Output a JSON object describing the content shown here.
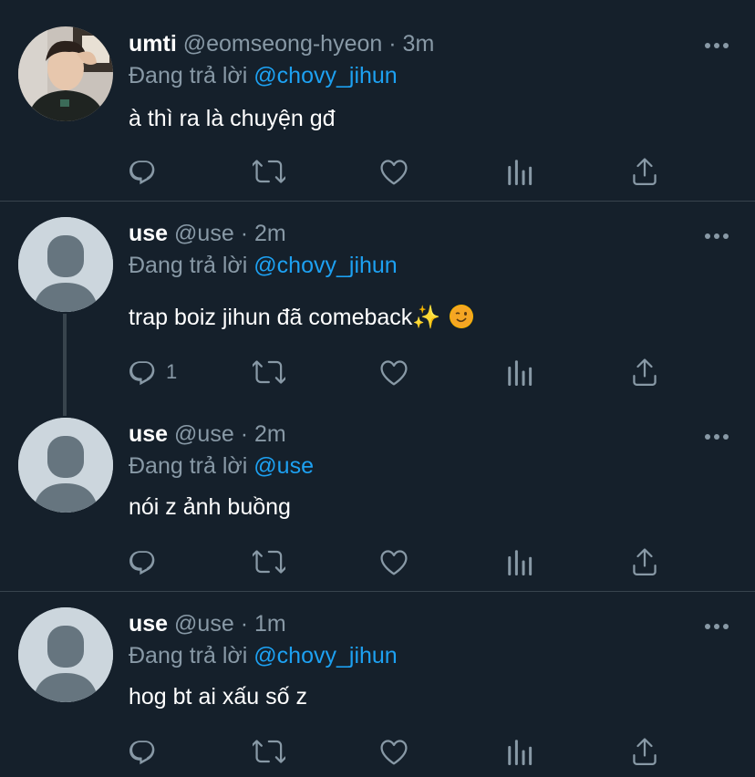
{
  "tweets": [
    {
      "name": "umti",
      "handle": "@eomseong-hyeon",
      "time": "· 3m",
      "replying_label": "Đang trả lời",
      "replying_to": "@chovy_jihun",
      "text": "à thì ra là chuyện gđ",
      "reply_count": ""
    },
    {
      "name": "use",
      "handle": "@use",
      "time": "· 2m",
      "replying_label": "Đang trả lời",
      "replying_to": "@chovy_jihun",
      "text": "trap boiz jihun đã comeback✨",
      "reply_count": "1"
    },
    {
      "name": "use",
      "handle": "@use",
      "time": "· 2m",
      "replying_label": "Đang trả lời",
      "replying_to": "@use",
      "text": "nói z ảnh buồng",
      "reply_count": ""
    },
    {
      "name": "use",
      "handle": "@use",
      "time": "· 1m",
      "replying_label": "Đang trả lời",
      "replying_to": "@chovy_jihun",
      "text": "hog bt ai xấu số z",
      "reply_count": ""
    }
  ],
  "icons": {
    "reply": "reply-icon",
    "retweet": "retweet-icon",
    "like": "heart-icon",
    "analytics": "analytics-icon",
    "share": "share-icon",
    "more": "more-icon",
    "emoji": "winking-face-emoji"
  },
  "colors": {
    "background": "#15202b",
    "divider": "#38444d",
    "secondary_text": "#8899a6",
    "link": "#1da1f2"
  }
}
